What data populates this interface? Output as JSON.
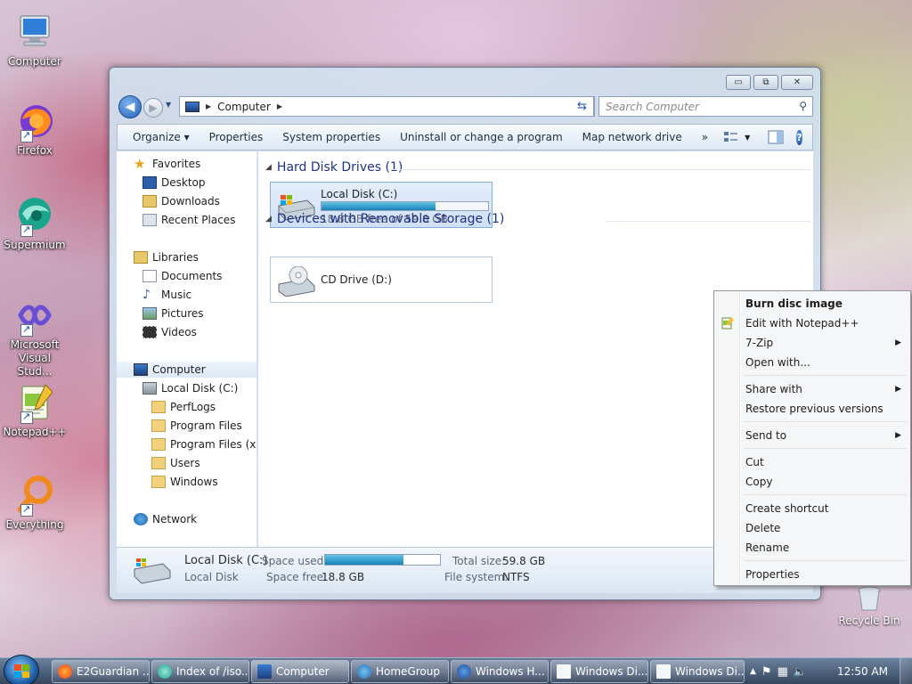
{
  "desktop": {
    "icons": [
      {
        "label": "Computer",
        "icon": "computer-icon"
      },
      {
        "label": "Firefox",
        "icon": "firefox-icon"
      },
      {
        "label": "Supermium",
        "icon": "supermium-icon"
      },
      {
        "label": "Microsoft Visual Stud...",
        "icon": "visual-studio-icon"
      },
      {
        "label": "Notepad++",
        "icon": "notepad-plus-plus-icon"
      },
      {
        "label": "Everything",
        "icon": "everything-icon"
      }
    ],
    "recycle_bin": "Recycle Bin"
  },
  "window": {
    "controls": {
      "minimize": "▭",
      "maximize": "⧉",
      "close": "✕"
    },
    "address": {
      "root": "Computer"
    },
    "search": {
      "placeholder": "Search Computer"
    },
    "toolbar": {
      "organize": "Organize ▾",
      "properties": "Properties",
      "system_properties": "System properties",
      "uninstall": "Uninstall or change a program",
      "map_drive": "Map network drive",
      "more": "»"
    },
    "nav": {
      "favorites": "Favorites",
      "desktop": "Desktop",
      "downloads": "Downloads",
      "recent": "Recent Places",
      "libraries": "Libraries",
      "documents": "Documents",
      "music": "Music",
      "pictures": "Pictures",
      "videos": "Videos",
      "computer": "Computer",
      "local_disk": "Local Disk (C:)",
      "perflogs": "PerfLogs",
      "program_files": "Program Files",
      "program_files_x86": "Program Files (x86",
      "users": "Users",
      "windows": "Windows",
      "network": "Network"
    },
    "groups": {
      "hdd": "Hard Disk Drives (1)",
      "removable": "Devices with Removable Storage (1)"
    },
    "drives": {
      "c": {
        "name": "Local Disk (C:)",
        "free": "18.8 GB free of 59.8 GB",
        "used_fraction": 0.686
      },
      "d": {
        "name": "CD Drive (D:)"
      }
    },
    "details": {
      "name": "Local Disk (C:)",
      "type": "Local Disk",
      "space_used_label": "Space used:",
      "space_free_label": "Space free:",
      "space_free": "18.8 GB",
      "total_label": "Total size:",
      "total": "59.8 GB",
      "fs_label": "File system:",
      "fs": "NTFS",
      "used_fraction": 0.686
    }
  },
  "context_menu": {
    "burn": "Burn disc image",
    "notepad": "Edit with Notepad++",
    "zip": "7-Zip",
    "open_with": "Open with...",
    "share": "Share with",
    "restore": "Restore previous versions",
    "send_to": "Send to",
    "cut": "Cut",
    "copy": "Copy",
    "shortcut": "Create shortcut",
    "delete": "Delete",
    "rename": "Rename",
    "properties": "Properties"
  },
  "taskbar": {
    "buttons": [
      {
        "label": "E2Guardian ...",
        "icon": "firefox-icon"
      },
      {
        "label": "Index of /iso...",
        "icon": "supermium-icon"
      },
      {
        "label": "Computer",
        "icon": "computer-icon"
      },
      {
        "label": "HomeGroup",
        "icon": "homegroup-icon"
      },
      {
        "label": "Windows H...",
        "icon": "help-icon"
      },
      {
        "label": "Windows Di...",
        "icon": "document-icon"
      },
      {
        "label": "Windows Di...",
        "icon": "document-icon"
      }
    ],
    "clock": "12:50 AM"
  },
  "colors": {
    "accent": "#1780b8",
    "selection": "#cfe0f7",
    "group_heading": "#1e3287"
  }
}
